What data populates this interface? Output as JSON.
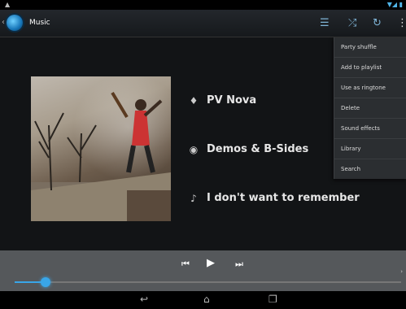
{
  "app": {
    "title": "Music"
  },
  "action_bar": {
    "icons": [
      "list-icon",
      "shuffle-icon",
      "repeat-icon",
      "overflow-menu-icon"
    ]
  },
  "now_playing": {
    "artist": "PV Nova",
    "album": "Demos & B-Sides",
    "track": "I don't want to remember",
    "progress_fraction": 0.08
  },
  "menu": {
    "items": [
      "Party shuffle",
      "Add to playlist",
      "Use as ringtone",
      "Delete",
      "Sound effects",
      "Library",
      "Search"
    ]
  },
  "colors": {
    "accent": "#39a6e8",
    "background": "#121416",
    "controls_bar": "#55585b"
  }
}
